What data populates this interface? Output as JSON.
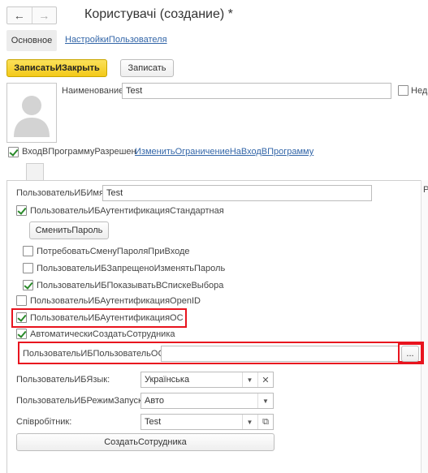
{
  "window": {
    "title": "Користувачі (создание) *"
  },
  "nav": {
    "back": "←",
    "forward": "→"
  },
  "tabs": {
    "basic": "Основное",
    "settings": "НастройкиПользователя"
  },
  "toolbar": {
    "save_close": "ЗаписатьИЗакрыть",
    "save": "Записать"
  },
  "header": {
    "name_label": "Наименование:",
    "name_value": "Test",
    "right_label": "Нед"
  },
  "login": {
    "allowed_label": "ВходВПрограммуРазрешен",
    "allowed_checked": true,
    "change_restriction_link": "ИзменитьОграничениеНаВходВПрограмму"
  },
  "panel": {
    "ib_name_label": "ПользовательИБИмя:",
    "ib_name_value": "Test",
    "std_auth_label": "ПользовательИБАутентификацияСтандартная",
    "change_password": "СменитьПароль",
    "require_change_label": "ПотребоватьСменуПароляПриВходе",
    "forbid_change_label": "ПользовательИБЗапрещеноИзменятьПароль",
    "show_in_list_label": "ПользовательИБПоказыватьВСпискеВыбора",
    "openid_label": "ПользовательИБАутентификацияOpenID",
    "os_auth_label": "ПользовательИБАутентификацияОС",
    "auto_create_label": "АвтоматическиСоздатьСотрудника",
    "os_user_label": "ПользовательИБПользовательОС:",
    "os_user_value": "",
    "os_user_button": "...",
    "language_label": "ПользовательИБЯзык:",
    "language_value": "Українська",
    "run_mode_label": "ПользовательИБРежимЗапуска:",
    "run_mode_value": "Авто",
    "employee_label": "Співробітник:",
    "employee_value": "Test",
    "create_employee": "СоздатьСотрудника",
    "right_col_label": "Р"
  },
  "colors": {
    "accent_yellow": "#f5cf2a",
    "link": "#3366a8",
    "highlight_red": "#e8141e",
    "check_green": "#2a8a2a"
  },
  "icons": {
    "dropdown": "chevron-down-icon",
    "clear": "close-icon",
    "open": "open-external-icon",
    "avatar": "user-silhouette-icon"
  }
}
